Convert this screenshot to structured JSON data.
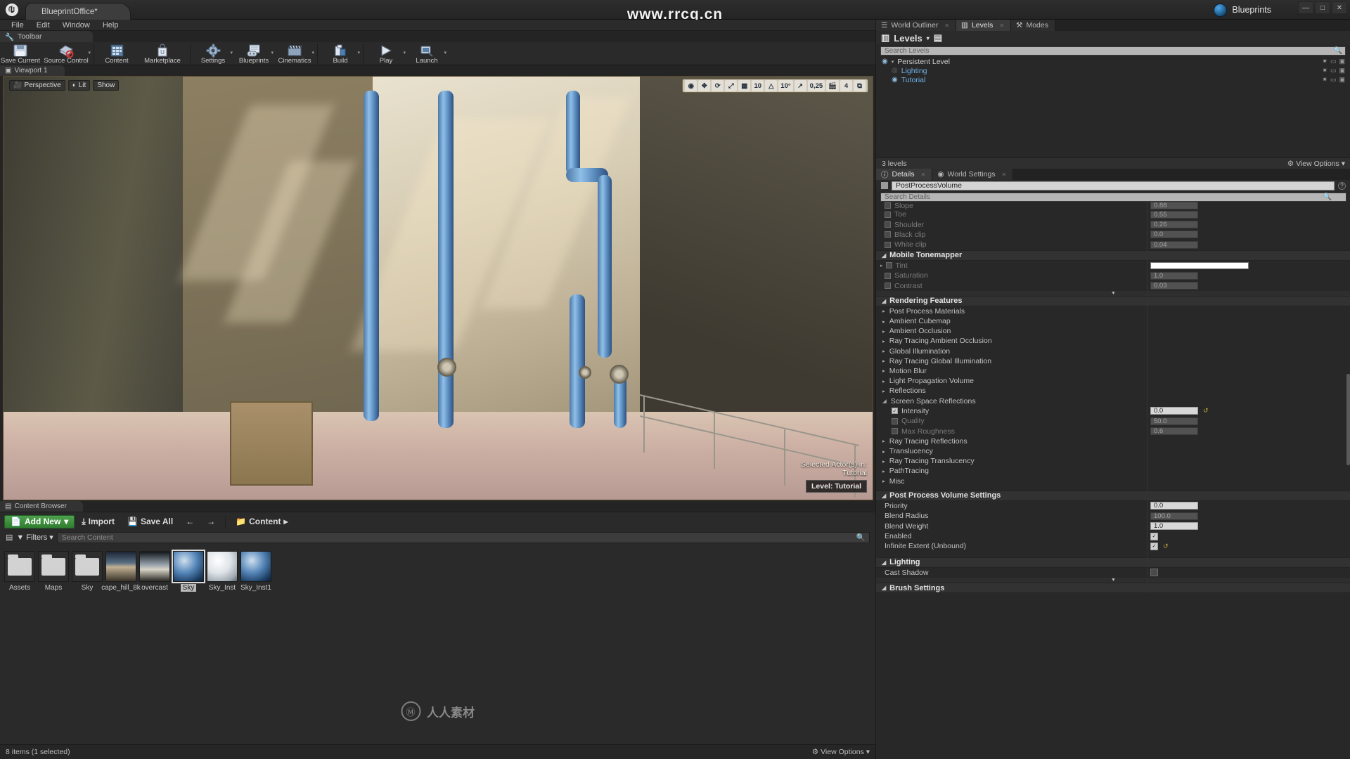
{
  "window": {
    "project_tab": "BlueprintOffice*",
    "center_watermark": "www.rrcg.cn",
    "blueprints_label": "Blueprints",
    "minimize": "—",
    "maximize": "□",
    "close": "✕"
  },
  "menu": {
    "items": [
      "File",
      "Edit",
      "Window",
      "Help"
    ]
  },
  "toolbar": {
    "tab_label": "Toolbar",
    "buttons": [
      {
        "label": "Save Current",
        "icon": "save-icon",
        "caret": false
      },
      {
        "label": "Source Control",
        "icon": "source-control-icon",
        "caret": true
      },
      {
        "label": "Content",
        "icon": "content-grid-icon",
        "caret": false
      },
      {
        "label": "Marketplace",
        "icon": "marketplace-bag-icon",
        "caret": false
      },
      {
        "label": "Settings",
        "icon": "gear-icon",
        "caret": true
      },
      {
        "label": "Blueprints",
        "icon": "blueprint-icon",
        "caret": true
      },
      {
        "label": "Cinematics",
        "icon": "clapperboard-icon",
        "caret": true
      },
      {
        "label": "Build",
        "icon": "build-cube-icon",
        "caret": true
      },
      {
        "label": "Play",
        "icon": "play-triangle-icon",
        "caret": true
      },
      {
        "label": "Launch",
        "icon": "launch-icon",
        "caret": true
      }
    ]
  },
  "viewport": {
    "tab_label": "Viewport 1",
    "perspective_label": "Perspective",
    "lit_label": "Lit",
    "show_label": "Show",
    "snap_controls": [
      {
        "name": "surface-snap-icon",
        "text": ""
      },
      {
        "name": "move-snap-icon",
        "text": ""
      },
      {
        "name": "grid-snap-toggle-icon",
        "text": ""
      },
      {
        "name": "grid-icon",
        "text": ""
      },
      {
        "name": "grid-size-value",
        "text": "10"
      },
      {
        "name": "angle-snap-icon",
        "text": ""
      },
      {
        "name": "angle-snap-value",
        "text": "10°"
      },
      {
        "name": "scale-snap-icon",
        "text": ""
      },
      {
        "name": "scale-snap-value",
        "text": "0,25"
      },
      {
        "name": "camera-speed-icon",
        "text": ""
      },
      {
        "name": "camera-speed-value",
        "text": "4"
      },
      {
        "name": "maximize-viewport-icon",
        "text": ""
      }
    ],
    "selection_line1": "Selected Actor(s) in:",
    "selection_line2": "Tutorial",
    "level_badge": "Level: Tutorial"
  },
  "content_browser": {
    "tab_label": "Content Browser",
    "add_new": "Add New",
    "import": "Import",
    "save_all": "Save All",
    "breadcrumb": "Content",
    "filters": "Filters",
    "search_placeholder": "Search Content",
    "assets": [
      {
        "name": "Assets",
        "type": "folder"
      },
      {
        "name": "Maps",
        "type": "folder"
      },
      {
        "name": "Sky",
        "type": "folder"
      },
      {
        "name": "cape_hill_8k",
        "type": "texture"
      },
      {
        "name": "overcast",
        "type": "texture"
      },
      {
        "name": "Sky",
        "type": "material",
        "selected": true
      },
      {
        "name": "Sky_Inst",
        "type": "material"
      },
      {
        "name": "Sky_Inst1",
        "type": "material"
      }
    ],
    "status": "8 items (1 selected)",
    "view_options": "View Options"
  },
  "right_panel": {
    "top_tabs": [
      {
        "label": "World Outliner",
        "icon": "list-icon",
        "active": false
      },
      {
        "label": "Levels",
        "icon": "levels-icon",
        "active": true
      },
      {
        "label": "Modes",
        "icon": "modes-icon",
        "active": false
      }
    ],
    "levels": {
      "title": "Levels",
      "search_placeholder": "Search Levels",
      "rows": [
        {
          "name": "Persistent Level",
          "indent": 0,
          "blue": false,
          "expander": true,
          "visible": true
        },
        {
          "name": "Lighting",
          "indent": 1,
          "blue": true,
          "expander": false,
          "visible": false
        },
        {
          "name": "Tutorial",
          "indent": 1,
          "blue": true,
          "expander": false,
          "visible": true
        }
      ],
      "status": "3 levels",
      "view_options": "View Options"
    },
    "details": {
      "tabs": [
        {
          "label": "Details",
          "icon": "details-icon",
          "active": true
        },
        {
          "label": "World Settings",
          "icon": "world-settings-icon",
          "active": false
        }
      ],
      "object_name": "PostProcessVolume",
      "search_placeholder": "Search Details",
      "clipped_rows": [
        {
          "label": "Slope",
          "value": "0.88",
          "dim": true
        },
        {
          "label": "Toe",
          "value": "0.55",
          "dim": true
        },
        {
          "label": "Shoulder",
          "value": "0.26",
          "dim": true
        },
        {
          "label": "Black clip",
          "value": "0.0",
          "dim": true
        },
        {
          "label": "White clip",
          "value": "0.04",
          "dim": true
        }
      ],
      "mobile_tonemapper": {
        "title": "Mobile Tonemapper",
        "rows": [
          {
            "label": "Tint",
            "value": "",
            "type": "color",
            "color": "#ffffff",
            "dim": true,
            "expander": true
          },
          {
            "label": "Saturation",
            "value": "1.0",
            "dim": true
          },
          {
            "label": "Contrast",
            "value": "0.03",
            "dim": true
          }
        ]
      },
      "rendering_features": {
        "title": "Rendering Features",
        "items": [
          "Post Process Materials",
          "Ambient Cubemap",
          "Ambient Occlusion",
          "Ray Tracing Ambient Occlusion",
          "Global Illumination",
          "Ray Tracing Global Illumination",
          "Motion Blur",
          "Light Propagation Volume",
          "Reflections"
        ],
        "ssr": {
          "title": "Screen Space Reflections",
          "rows": [
            {
              "label": "Intensity",
              "value": "0.0",
              "checked": true,
              "dim": false,
              "reset": true
            },
            {
              "label": "Quality",
              "value": "50.0",
              "checked": false,
              "dim": true
            },
            {
              "label": "Max Roughness",
              "value": "0.6",
              "checked": false,
              "dim": true
            }
          ]
        },
        "items_after": [
          "Ray Tracing Reflections",
          "Translucency",
          "Ray Tracing Translucency",
          "PathTracing",
          "Misc"
        ]
      },
      "ppv_settings": {
        "title": "Post Process Volume Settings",
        "rows": [
          {
            "label": "Priority",
            "value": "0.0",
            "type": "number",
            "bright": true
          },
          {
            "label": "Blend Radius",
            "value": "100.0",
            "type": "number",
            "bright": false
          },
          {
            "label": "Blend Weight",
            "value": "1.0",
            "type": "number",
            "bright": true
          },
          {
            "label": "Enabled",
            "value": "",
            "type": "checkbox",
            "checked": true
          },
          {
            "label": "Infinite Extent (Unbound)",
            "value": "",
            "type": "checkbox",
            "checked": true,
            "reset": true
          }
        ]
      },
      "lighting": {
        "title": "Lighting",
        "rows": [
          {
            "label": "Cast Shadow",
            "type": "checkbox",
            "checked": false
          }
        ]
      },
      "brush_settings": {
        "title": "Brush Settings"
      }
    }
  },
  "watermarks": {
    "logo_text": "人人素材",
    "logo_mark": "Ⓜ"
  },
  "colors": {
    "accent_green": "#3f8f3f",
    "link_blue": "#6fb2e8",
    "panel_bg": "#282828"
  }
}
